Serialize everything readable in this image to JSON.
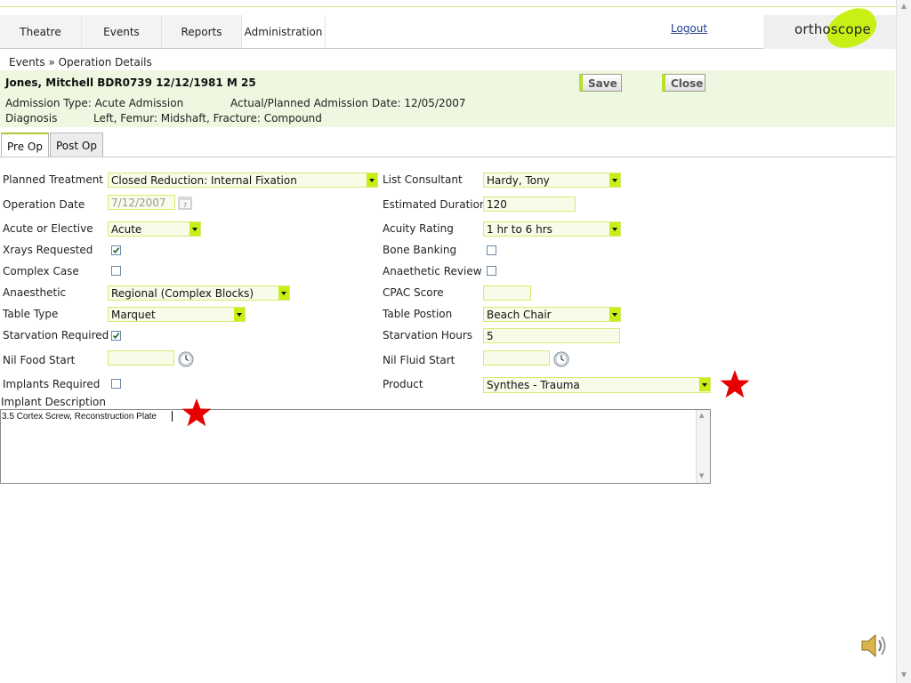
{
  "nav": {
    "tabs": [
      {
        "label": "Theatre"
      },
      {
        "label": "Events"
      },
      {
        "label": "Reports"
      },
      {
        "label": "Administration"
      }
    ],
    "logout": "Logout",
    "logo": "orthoscope"
  },
  "breadcrumb": "Events » Operation Details",
  "header": {
    "patient": "Jones, Mitchell BDR0739 12/12/1981 M 25",
    "admission_type": "Admission Type: Acute Admission",
    "admission_date": "Actual/Planned Admission Date: 12/05/2007",
    "diagnosis_label": "Diagnosis",
    "diagnosis_value": "Left, Femur: Midshaft, Fracture: Compound",
    "save_label": "Save",
    "close_label": "Close"
  },
  "tabs": {
    "pre_op": "Pre Op",
    "post_op": "Post Op"
  },
  "form": {
    "planned_treatment": {
      "label": "Planned Treatment",
      "value": "Closed Reduction: Internal Fixation"
    },
    "operation_date": {
      "label": "Operation Date",
      "value": "7/12/2007"
    },
    "acute_or_elective": {
      "label": "Acute or Elective",
      "value": "Acute"
    },
    "xrays_requested": {
      "label": "Xrays Requested",
      "checked": true
    },
    "complex_case": {
      "label": "Complex Case",
      "checked": false
    },
    "anaesthetic": {
      "label": "Anaesthetic",
      "value": "Regional (Complex Blocks)"
    },
    "table_type": {
      "label": "Table Type",
      "value": "Marquet"
    },
    "starvation_required": {
      "label": "Starvation Required",
      "checked": true
    },
    "nil_food_start": {
      "label": "Nil Food Start",
      "value": ""
    },
    "implants_required": {
      "label": "Implants Required",
      "checked": false
    },
    "list_consultant": {
      "label": "List Consultant",
      "value": "Hardy, Tony"
    },
    "estimated_duration": {
      "label": "Estimated Duration",
      "value": "120"
    },
    "acuity_rating": {
      "label": "Acuity Rating",
      "value": "1 hr to 6 hrs"
    },
    "bone_banking": {
      "label": "Bone Banking",
      "checked": false
    },
    "anaethetic_review": {
      "label": "Anaethetic Review",
      "checked": false
    },
    "cpac_score": {
      "label": "CPAC Score",
      "value": ""
    },
    "table_postion": {
      "label": "Table Postion",
      "value": "Beach Chair"
    },
    "starvation_hours": {
      "label": "Starvation Hours",
      "value": "5"
    },
    "nil_fluid_start": {
      "label": "Nil Fluid Start",
      "value": ""
    },
    "product": {
      "label": "Product",
      "value": "Synthes - Trauma"
    },
    "implant_description": {
      "label": "Implant Description",
      "value": "3.5 Cortex Screw, Reconstruction Plate"
    }
  },
  "colors": {
    "accent": "#c6ef16",
    "header_band": "#eef7df",
    "field_border": "#d9ea72",
    "star": "#e60000"
  },
  "icons": [
    "calendar-icon",
    "clock-icon",
    "star-marker-icon",
    "speaker-icon"
  ]
}
